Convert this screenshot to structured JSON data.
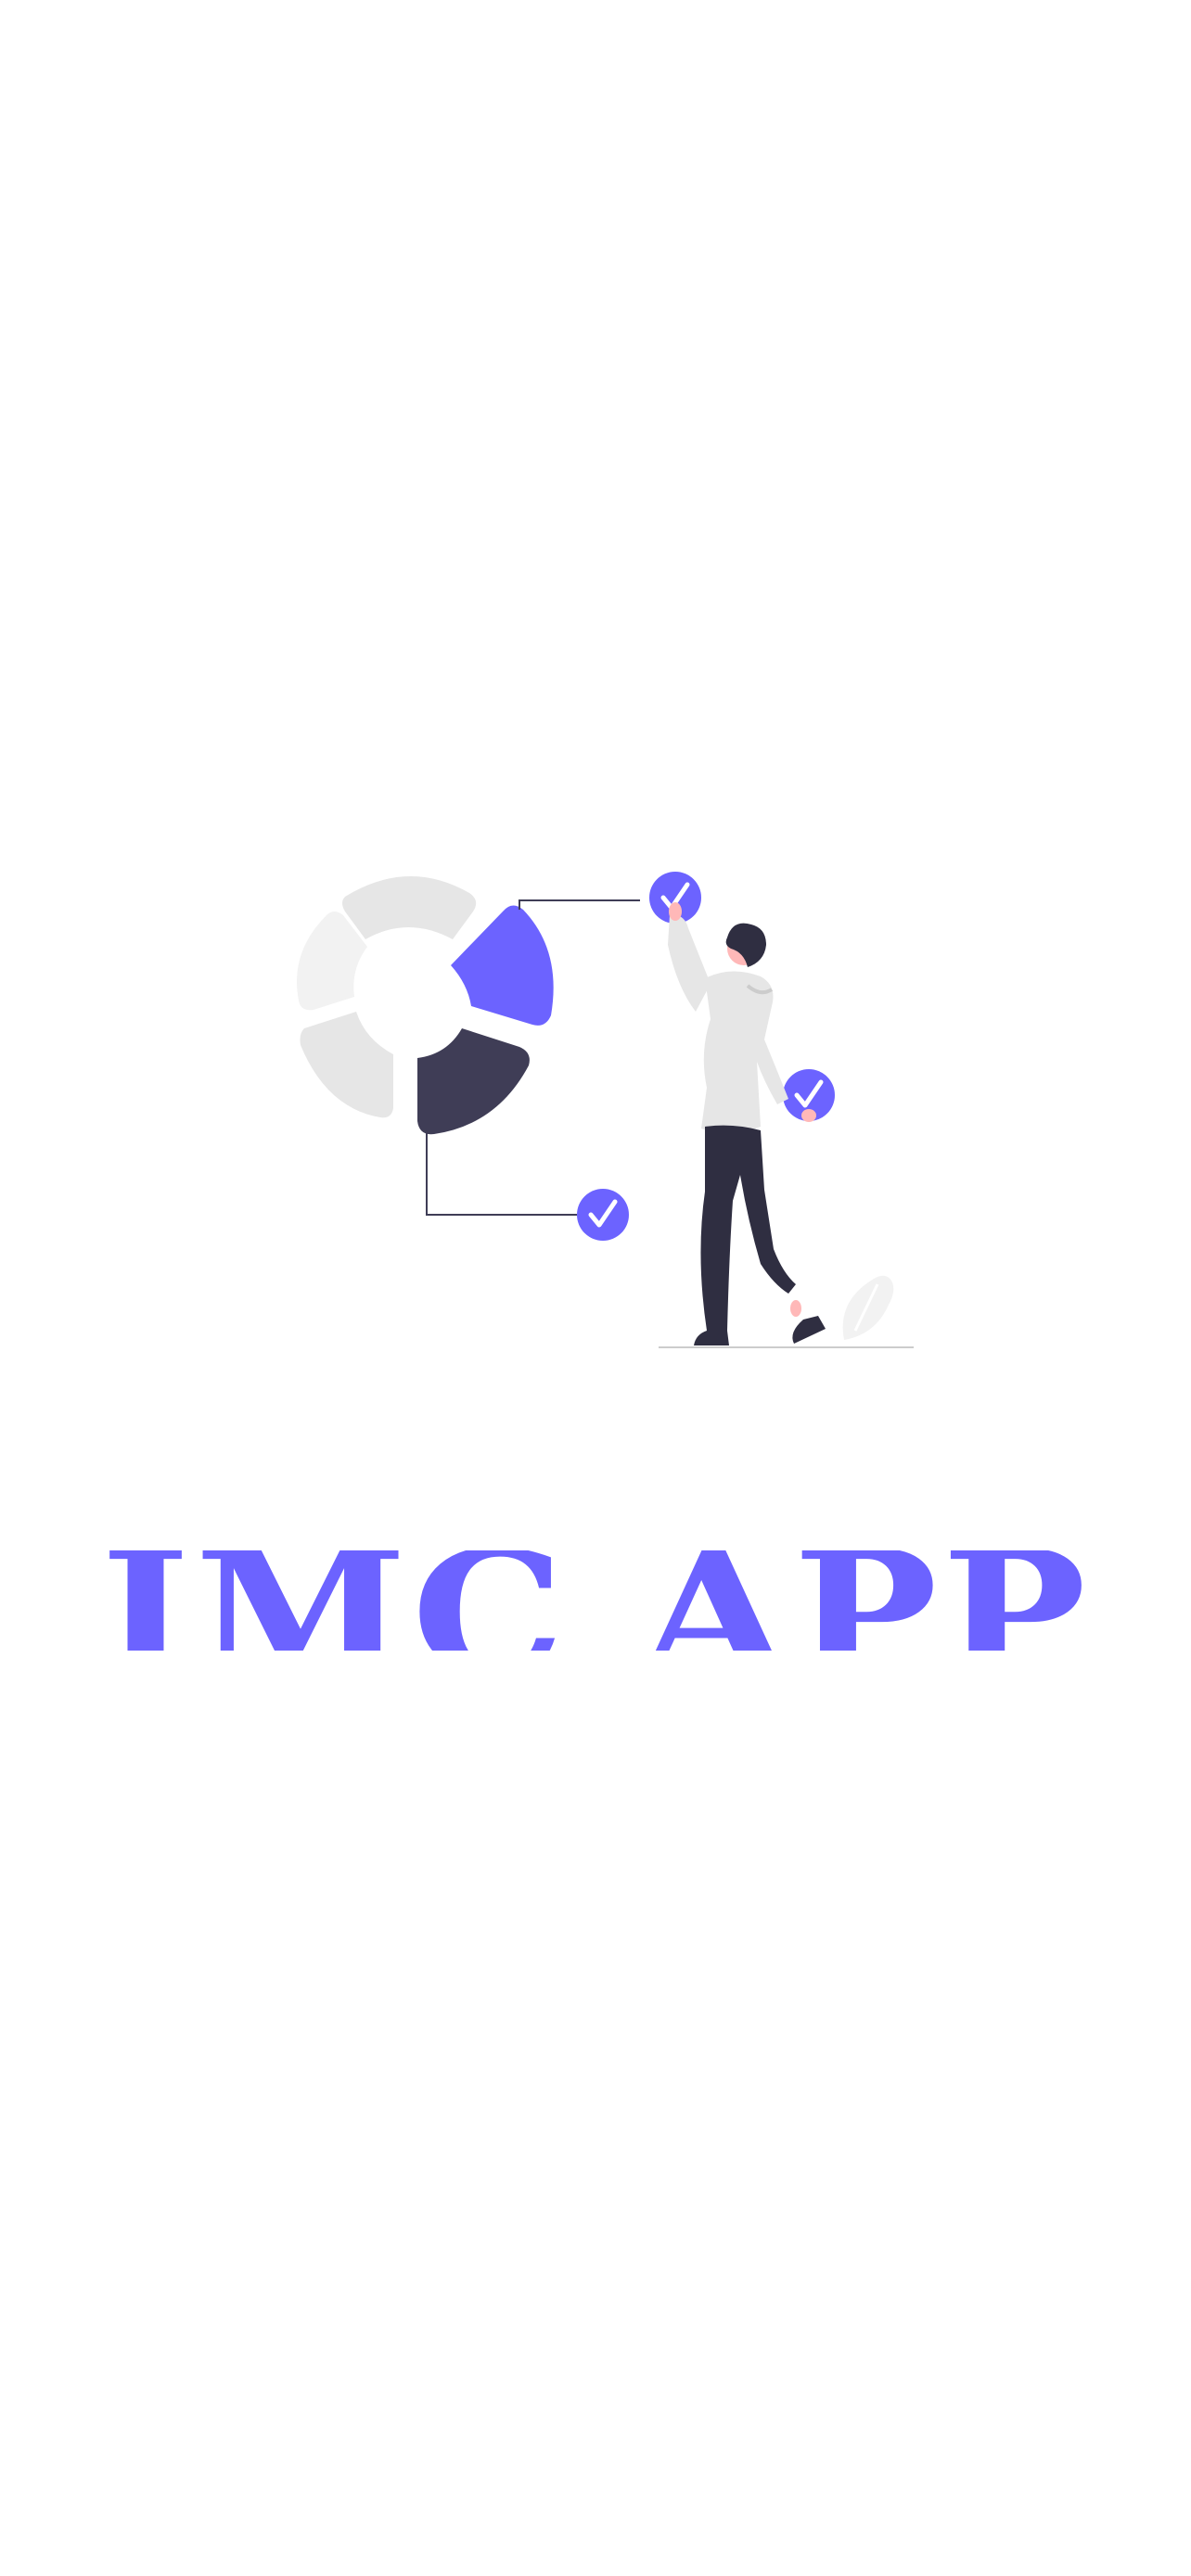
{
  "app": {
    "title": "IMC APP"
  },
  "illustration": {
    "icon": "person-chart-checklist-illustration",
    "colors": {
      "accent": "#6c63ff",
      "dark": "#3f3d56",
      "light_gray": "#e6e6e6",
      "lighter_gray": "#f2f2f2",
      "skin": "#ffb8b8",
      "hair": "#2f2e41"
    }
  }
}
